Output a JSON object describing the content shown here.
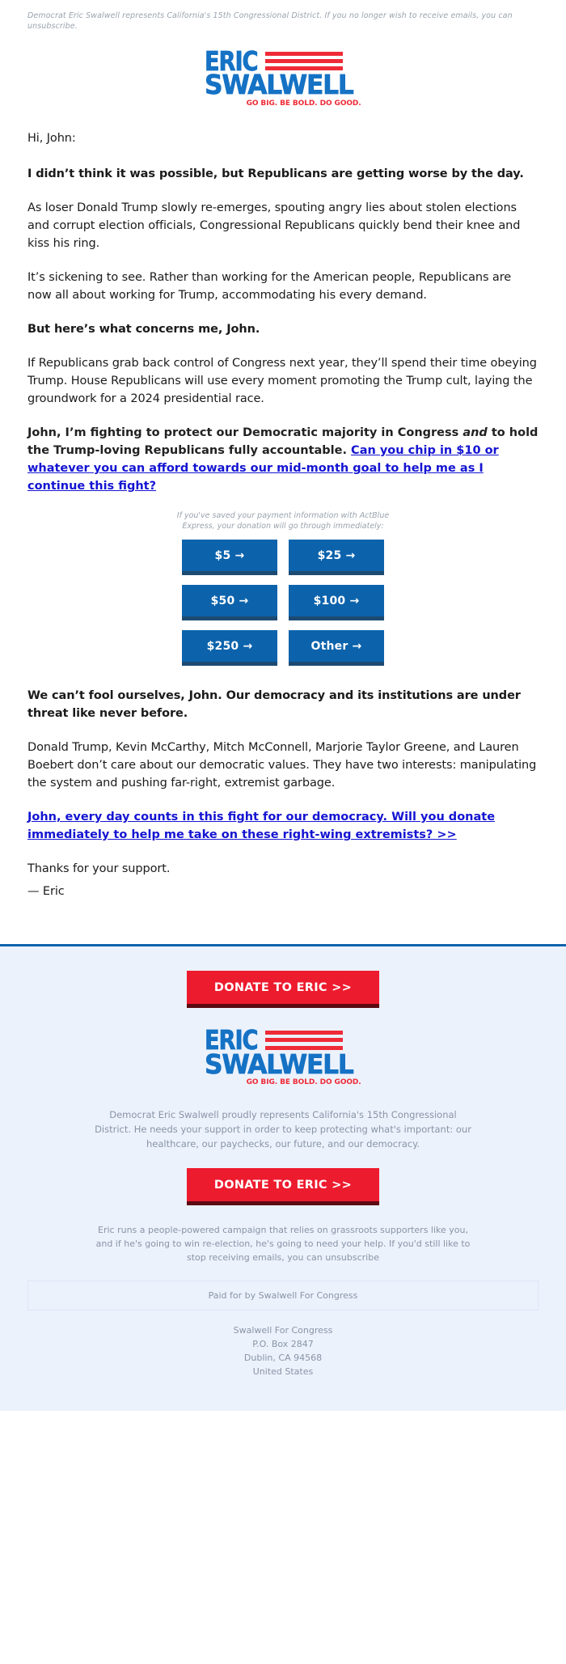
{
  "preheader": "Democrat Eric Swalwell represents California's 15th Congressional District. If you no longer wish to receive emails, you can unsubscribe.",
  "logo": {
    "line1": "ERIC",
    "line2": "SWALWELL",
    "tagline": "GO BIG. BE BOLD. DO GOOD.",
    "blue": "#1572c4",
    "red": "#ee2b37"
  },
  "email": {
    "greeting": "Hi, John:",
    "p1_bold": "I didn’t think it was possible, but Republicans are getting worse by the day.",
    "p2": "As loser Donald Trump slowly re-emerges, spouting angry lies about stolen elections and corrupt election officials, Congressional Republicans quickly bend their knee and kiss his ring.",
    "p3": "It’s sickening to see. Rather than working for the American people, Republicans are now all about working for Trump, accommodating his every demand.",
    "p4_bold": "But here’s what concerns me, John.",
    "p5": "If Republicans grab back control of Congress next year, they’ll spend their time obeying Trump. House Republicans will use every moment promoting the Trump cult, laying the groundwork for a 2024 presidential race.",
    "p6_a": "John, I’m fighting to protect our Democratic majority in Congress ",
    "p6_italic": "and",
    "p6_b": " to hold the Trump-loving Republicans fully accountable. ",
    "p6_link": "Can you chip in $10 or whatever you can afford towards our mid-month goal to help me as I continue this fight?",
    "p7_bold": "We can’t fool ourselves, John. Our democracy and its institutions are under threat like never before.",
    "p8": "Donald Trump, Kevin McCarthy, Mitch McConnell, Marjorie Taylor Greene, and Lauren Boebert don’t care about our democratic values. They have two interests: manipulating the system and pushing far-right, extremist garbage.",
    "p9_link": "John, every day counts in this fight for our democracy. Will you donate immediately to help me take on these right-wing extremists? >>",
    "thanks": "Thanks for your support.",
    "signature": "— Eric"
  },
  "donation": {
    "note": "If you've saved your payment information with ActBlue Express, your donation will go through immediately:",
    "buttons": [
      {
        "label": "$5 →"
      },
      {
        "label": "$25 →"
      },
      {
        "label": "$50 →"
      },
      {
        "label": "$100 →"
      },
      {
        "label": "$250 →"
      },
      {
        "label": "Other →"
      }
    ],
    "button_color": "#0c63ac",
    "button_shadow": "#1c4a72"
  },
  "footer": {
    "cta_top": "DONATE TO ERIC >>",
    "cta_bottom": "DONATE TO ERIC >>",
    "cta_color": "#ed1b2e",
    "text1": "Democrat Eric Swalwell proudly represents California's 15th Congressional District. He needs your support in order to keep protecting what's important: our healthcare, our paychecks, our future, and our democracy.",
    "text2": "Eric runs a people-powered campaign that relies on grassroots supporters like you, and if he's going to win re-election, he's going to need your help. If you'd still like to stop receiving emails, you can unsubscribe",
    "paid_for": "Paid for by Swalwell For Congress",
    "address": {
      "org": "Swalwell For Congress",
      "line1": "P.O. Box 2847",
      "line2": "Dublin, CA 94568",
      "line3": "United States"
    },
    "background": "#ecf2fc",
    "rule_color": "#0c63ac"
  }
}
